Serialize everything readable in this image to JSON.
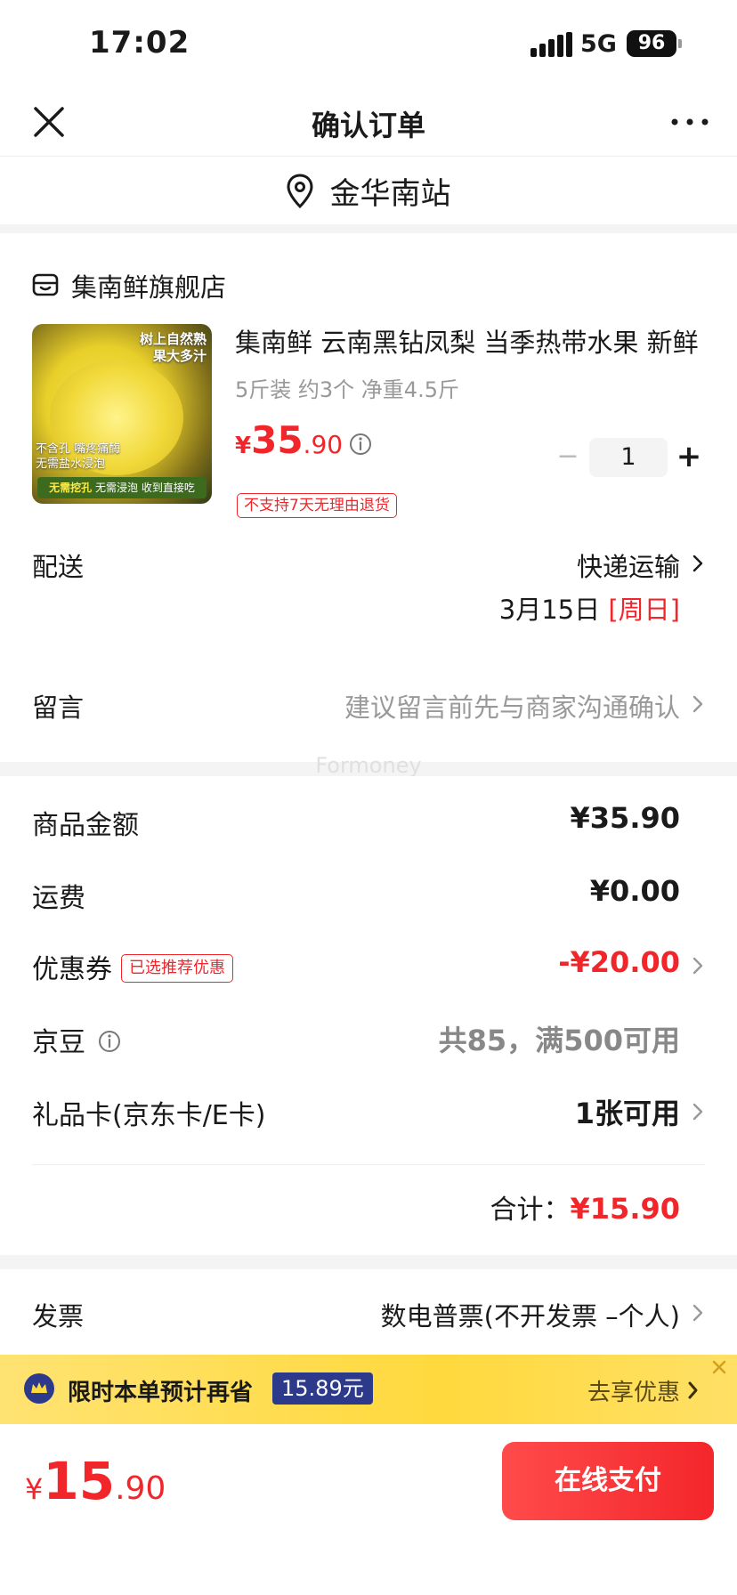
{
  "status_bar": {
    "time": "17:02",
    "network": "5G",
    "battery": "96"
  },
  "nav": {
    "title": "确认订单"
  },
  "location": {
    "text": "金华南站"
  },
  "shop": {
    "name": "集南鲜旗舰店"
  },
  "product": {
    "image_text_top": "树上自然熟\n果大多汁",
    "image_text_mid": "不含孔 嘴疼痛酶\n无需盐水浸泡",
    "image_text_bottom_1": "无需挖孔",
    "image_text_bottom_2": "无需浸泡 收到直接吃",
    "title": "集南鲜 云南黑钻凤梨 当季热带水果 新鲜",
    "spec": "5斤装 约3个 净重4.5斤",
    "price_currency": "¥",
    "price_int": "35",
    "price_dec": ".90",
    "quantity": "1",
    "minus_label": "−",
    "plus_label": "+",
    "return_badge": "不支持7天无理由退货"
  },
  "delivery": {
    "label": "配送",
    "method": "快递运输",
    "date": "3月15日",
    "weekday": "[周日]"
  },
  "message": {
    "label": "留言",
    "hint": "建议留言前先与商家沟通确认"
  },
  "watermark": "Formoney",
  "prices": {
    "goods_label": "商品金额",
    "goods_value": "¥35.90",
    "shipping_label": "运费",
    "shipping_value": "¥0.00",
    "coupon_label": "优惠券",
    "coupon_badge": "已选推荐优惠",
    "coupon_value": "-¥20.00",
    "jd_bean_label": "京豆",
    "jd_bean_value": "共85，满500可用",
    "gift_card_label": "礼品卡(京东卡/E卡)",
    "gift_card_value": "1张可用",
    "total_label": "合计：",
    "total_value": "¥15.90"
  },
  "invoice": {
    "label": "发票",
    "value": "数电普票(不开发票 –个人)"
  },
  "promo": {
    "text": "限时本单预计再省",
    "amount": "15.89元",
    "action": "去享优惠"
  },
  "bottom": {
    "currency": "¥",
    "total_int": "15",
    "total_dec": ".90",
    "pay_label": "在线支付"
  },
  "colors": {
    "accent_red": "#f0262b",
    "promo_yellow": "#ffd93d",
    "promo_badge": "#2d3a8c"
  }
}
